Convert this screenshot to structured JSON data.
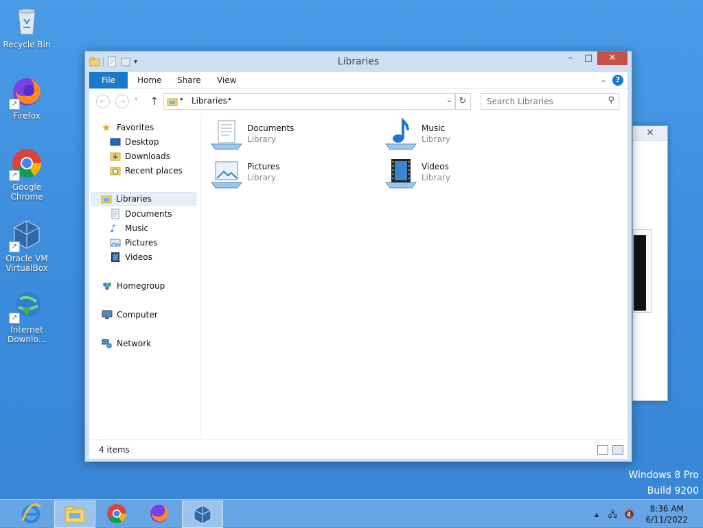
{
  "desktop": {
    "icons": [
      {
        "label_line1": "Recycle Bin",
        "label_line2": ""
      },
      {
        "label_line1": "Firefox",
        "label_line2": ""
      },
      {
        "label_line1": "Google",
        "label_line2": "Chrome"
      },
      {
        "label_line1": "Oracle VM",
        "label_line2": "VirtualBox"
      },
      {
        "label_line1": "Internet",
        "label_line2": "Downlo..."
      }
    ],
    "watermark_line1": "Windows 8 Pro",
    "watermark_line2": "Build 9200"
  },
  "window": {
    "title": "Libraries",
    "controls": {
      "minimize": "–",
      "maximize": "□",
      "close": "✕"
    },
    "ribbon_tabs": [
      "File",
      "Home",
      "Share",
      "View"
    ],
    "help": "?",
    "address_path": "Libraries",
    "search_placeholder": "Search Libraries",
    "nav": {
      "favorites": "Favorites",
      "favorites_items": [
        "Desktop",
        "Downloads",
        "Recent places"
      ],
      "libraries": "Libraries",
      "libraries_items": [
        "Documents",
        "Music",
        "Pictures",
        "Videos"
      ],
      "homegroup": "Homegroup",
      "computer": "Computer",
      "network": "Network"
    },
    "items": [
      {
        "name": "Documents",
        "type": "Library"
      },
      {
        "name": "Music",
        "type": "Library"
      },
      {
        "name": "Pictures",
        "type": "Library"
      },
      {
        "name": "Videos",
        "type": "Library"
      }
    ],
    "status": "4 items"
  },
  "taskbar": {
    "apps": [
      "Internet Explorer",
      "File Explorer",
      "Google Chrome",
      "Firefox",
      "Oracle VM VirtualBox"
    ],
    "time": "8:36 AM",
    "date": "6/11/2022"
  },
  "colors": {
    "accent": "#1979ca",
    "close": "#c7504a",
    "desktop": "#3b8bdc"
  }
}
